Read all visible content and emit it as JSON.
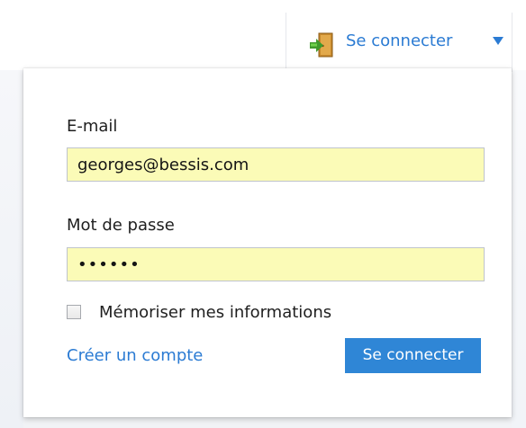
{
  "header": {
    "signin_trigger_label": "Se connecter",
    "signin_icon": "door-enter-icon",
    "dropdown_icon": "triangle-down-icon"
  },
  "login_form": {
    "email_label": "E-mail",
    "email_value": "georges@bessis.com",
    "password_label": "Mot de passe",
    "password_value": "••••••",
    "remember_label": "Mémoriser mes informations",
    "remember_checked": false,
    "create_account_label": "Créer un compte",
    "submit_label": "Se connecter"
  },
  "colors": {
    "accent": "#2b7bd3",
    "button": "#2f86d6",
    "input_autofill": "#fbfbb7"
  }
}
